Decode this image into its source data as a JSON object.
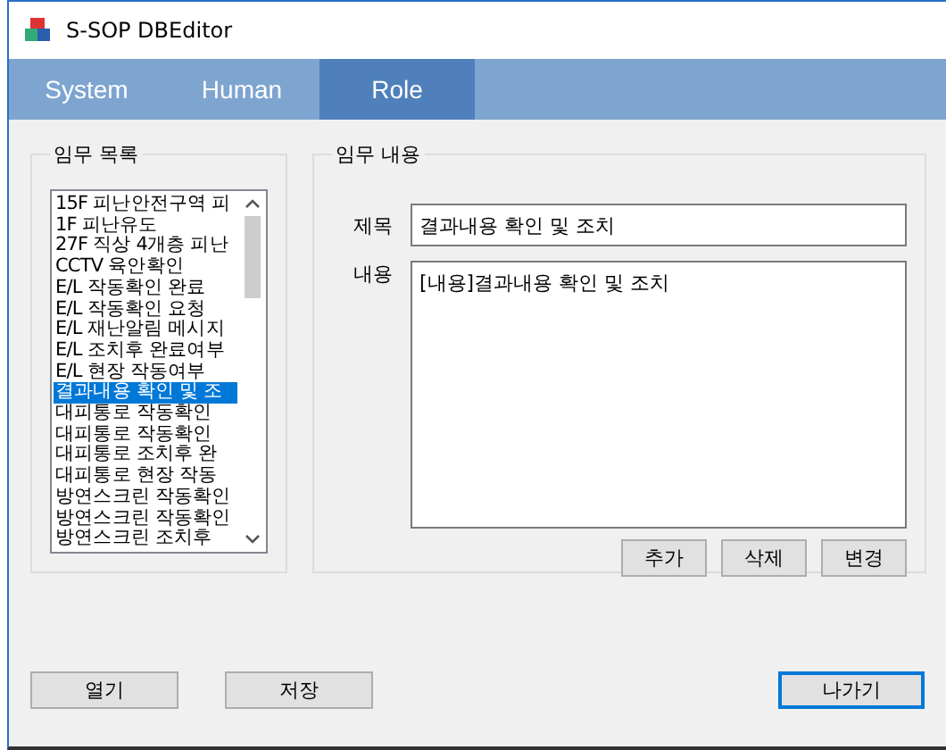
{
  "window": {
    "title": "S-SOP DBEditor"
  },
  "tabs": [
    {
      "label": "System",
      "selected": false
    },
    {
      "label": "Human",
      "selected": false
    },
    {
      "label": "Role",
      "selected": true
    }
  ],
  "task_list": {
    "title": "임무 목록",
    "items": [
      {
        "label": "15F 피난안전구역 피",
        "selected": false
      },
      {
        "label": "1F 피난유도",
        "selected": false
      },
      {
        "label": "27F 직상 4개층 피난",
        "selected": false
      },
      {
        "label": "CCTV 육안확인",
        "selected": false
      },
      {
        "label": "E/L 작동확인 완료",
        "selected": false
      },
      {
        "label": "E/L 작동확인 요청",
        "selected": false
      },
      {
        "label": "E/L 재난알림 메시지",
        "selected": false
      },
      {
        "label": "E/L 조치후 완료여부",
        "selected": false
      },
      {
        "label": "E/L 현장 작동여부",
        "selected": false
      },
      {
        "label": "결과내용 확인 및 조",
        "selected": true
      },
      {
        "label": "대피통로 작동확인",
        "selected": false
      },
      {
        "label": "대피통로 작동확인",
        "selected": false
      },
      {
        "label": "대피통로 조치후 완",
        "selected": false
      },
      {
        "label": "대피통로 현장 작동",
        "selected": false
      },
      {
        "label": "방연스크린 작동확인",
        "selected": false
      },
      {
        "label": "방연스크린 작동확인",
        "selected": false
      },
      {
        "label": "방연스크린 조치후",
        "selected": false
      }
    ]
  },
  "task_detail": {
    "title": "임무 내용",
    "title_label": "제목",
    "title_value": "결과내용 확인 및 조치",
    "content_label": "내용",
    "content_value": "[내용]결과내용 확인 및 조치",
    "buttons": [
      "추가",
      "삭제",
      "변경"
    ]
  },
  "footer": {
    "left_buttons": [
      "열기",
      "저장"
    ],
    "exit_button": "나가기"
  }
}
